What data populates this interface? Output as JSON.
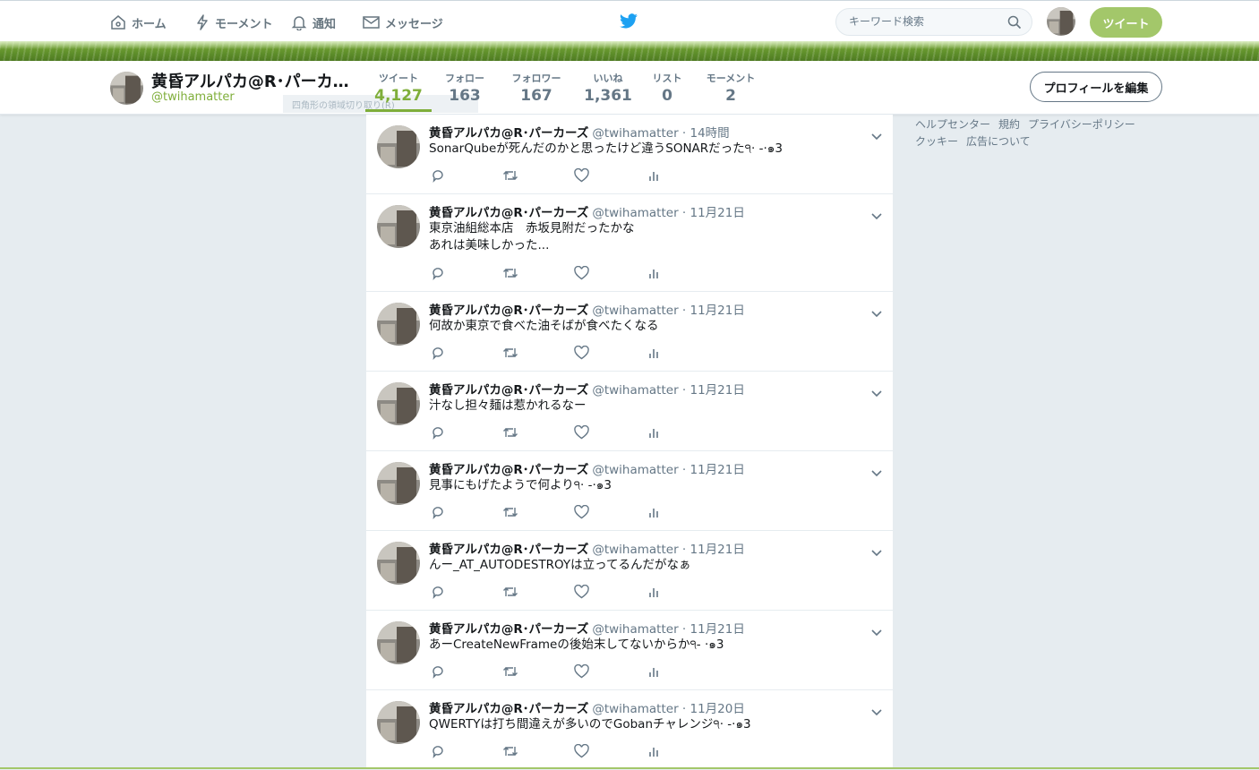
{
  "nav": {
    "home": "ホーム",
    "moments": "モーメント",
    "notifications": "通知",
    "messages": "メッセージ",
    "search_placeholder": "キーワード検索",
    "tweet_button": "ツイート"
  },
  "profile": {
    "name": "黄昏アルパカ@R･パーカ…",
    "handle": "@twihamatter",
    "edit_button": "プロフィールを編集",
    "ghost_text": "四角形の領域切り取り(R)",
    "stats": [
      {
        "label": "ツイート",
        "value": "4,127"
      },
      {
        "label": "フォロー",
        "value": "163"
      },
      {
        "label": "フォロワー",
        "value": "167"
      },
      {
        "label": "いいね",
        "value": "1,361"
      },
      {
        "label": "リスト",
        "value": "0"
      },
      {
        "label": "モーメント",
        "value": "2"
      }
    ]
  },
  "footer": {
    "links": [
      "ヘルプセンター",
      "規約",
      "プライバシーポリシー",
      "クッキー",
      "広告について"
    ]
  },
  "tweets": [
    {
      "name": "黄昏アルパカ@R･パーカーズ",
      "handle": "@twihamatter",
      "date": "· 14時間",
      "text": "SonarQubeが死んだのかと思ったけど違うSONARだった੧· -·๑3"
    },
    {
      "name": "黄昏アルパカ@R･パーカーズ",
      "handle": "@twihamatter",
      "date": "· 11月21日",
      "text": "東京油組総本店　赤坂見附だったかな\nあれは美味しかった..."
    },
    {
      "name": "黄昏アルパカ@R･パーカーズ",
      "handle": "@twihamatter",
      "date": "· 11月21日",
      "text": "何故か東京で食べた油そばが食べたくなる"
    },
    {
      "name": "黄昏アルパカ@R･パーカーズ",
      "handle": "@twihamatter",
      "date": "· 11月21日",
      "text": "汁なし担々麺は惹かれるなー"
    },
    {
      "name": "黄昏アルパカ@R･パーカーズ",
      "handle": "@twihamatter",
      "date": "· 11月21日",
      "text": "見事にもげたようで何より੧· -·๑3"
    },
    {
      "name": "黄昏アルパカ@R･パーカーズ",
      "handle": "@twihamatter",
      "date": "· 11月21日",
      "text": "んー_AT_AUTODESTROYは立ってるんだがなぁ"
    },
    {
      "name": "黄昏アルパカ@R･パーカーズ",
      "handle": "@twihamatter",
      "date": "· 11月21日",
      "text": "あーCreateNewFrameの後始末してないからか੧- ·๑3"
    },
    {
      "name": "黄昏アルパカ@R･パーカーズ",
      "handle": "@twihamatter",
      "date": "· 11月20日",
      "text": "QWERTYは打ち間違えが多いのでGobanチャレンジ੧· -·๑3"
    }
  ],
  "colors": {
    "accent": "#7fae3a",
    "tweet_button": "#a3c76a",
    "twitter_blue": "#1da1f2"
  }
}
